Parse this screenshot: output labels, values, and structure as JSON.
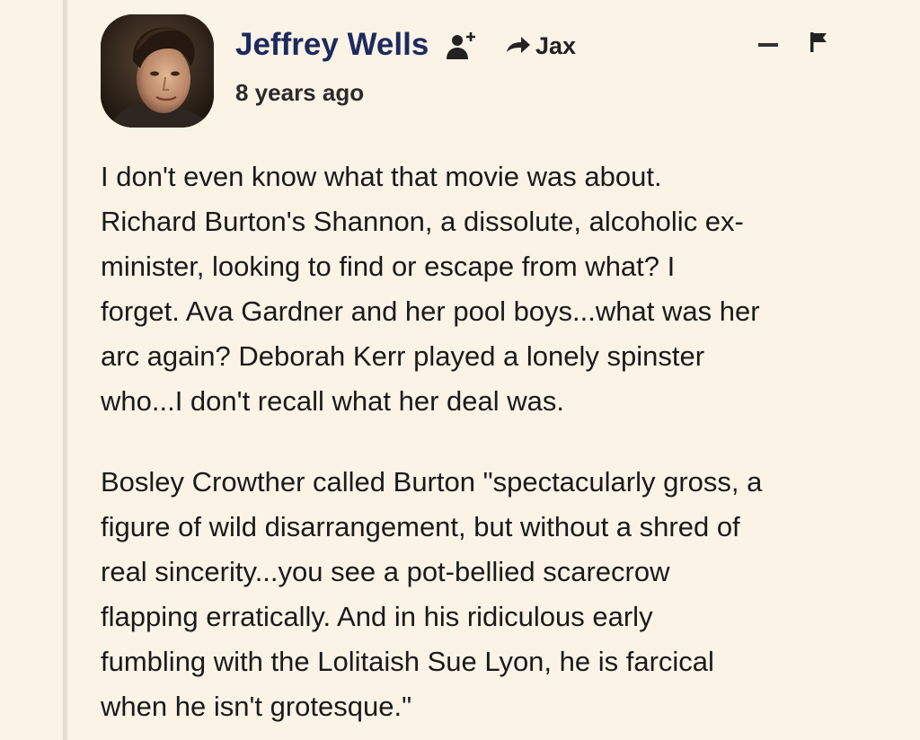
{
  "comment": {
    "author": "Jeffrey Wells",
    "timestamp": "8 years ago",
    "reply_to": "Jax",
    "icons": {
      "follow": "add-user-icon",
      "reply": "reply-arrow-icon",
      "collapse": "minus-icon",
      "flag": "flag-icon"
    },
    "paragraphs": [
      "I don't even know what that movie was about.\nRichard Burton's Shannon, a dissolute, alcoholic ex-\nminister, looking to find or escape from what? I\nforget. Ava Gardner and her pool boys...what was her\narc again? Deborah Kerr played a lonely spinster\nwho...I don't recall what her deal was.",
      "Bosley Crowther called Burton \"spectacularly gross, a\nfigure of wild disarrangement, but without a shred of\nreal sincerity...you see a pot-bellied scarecrow\nflapping erratically. And in his ridiculous early\nfumbling with the Lolitaish Sue Lyon, he is farcical\nwhen he isn't grotesque.\""
    ]
  },
  "colors": {
    "background": "#fbf3e6",
    "author": "#1c2a5e",
    "text": "#1a1a1a",
    "thread_line": "#e5ddd0"
  }
}
